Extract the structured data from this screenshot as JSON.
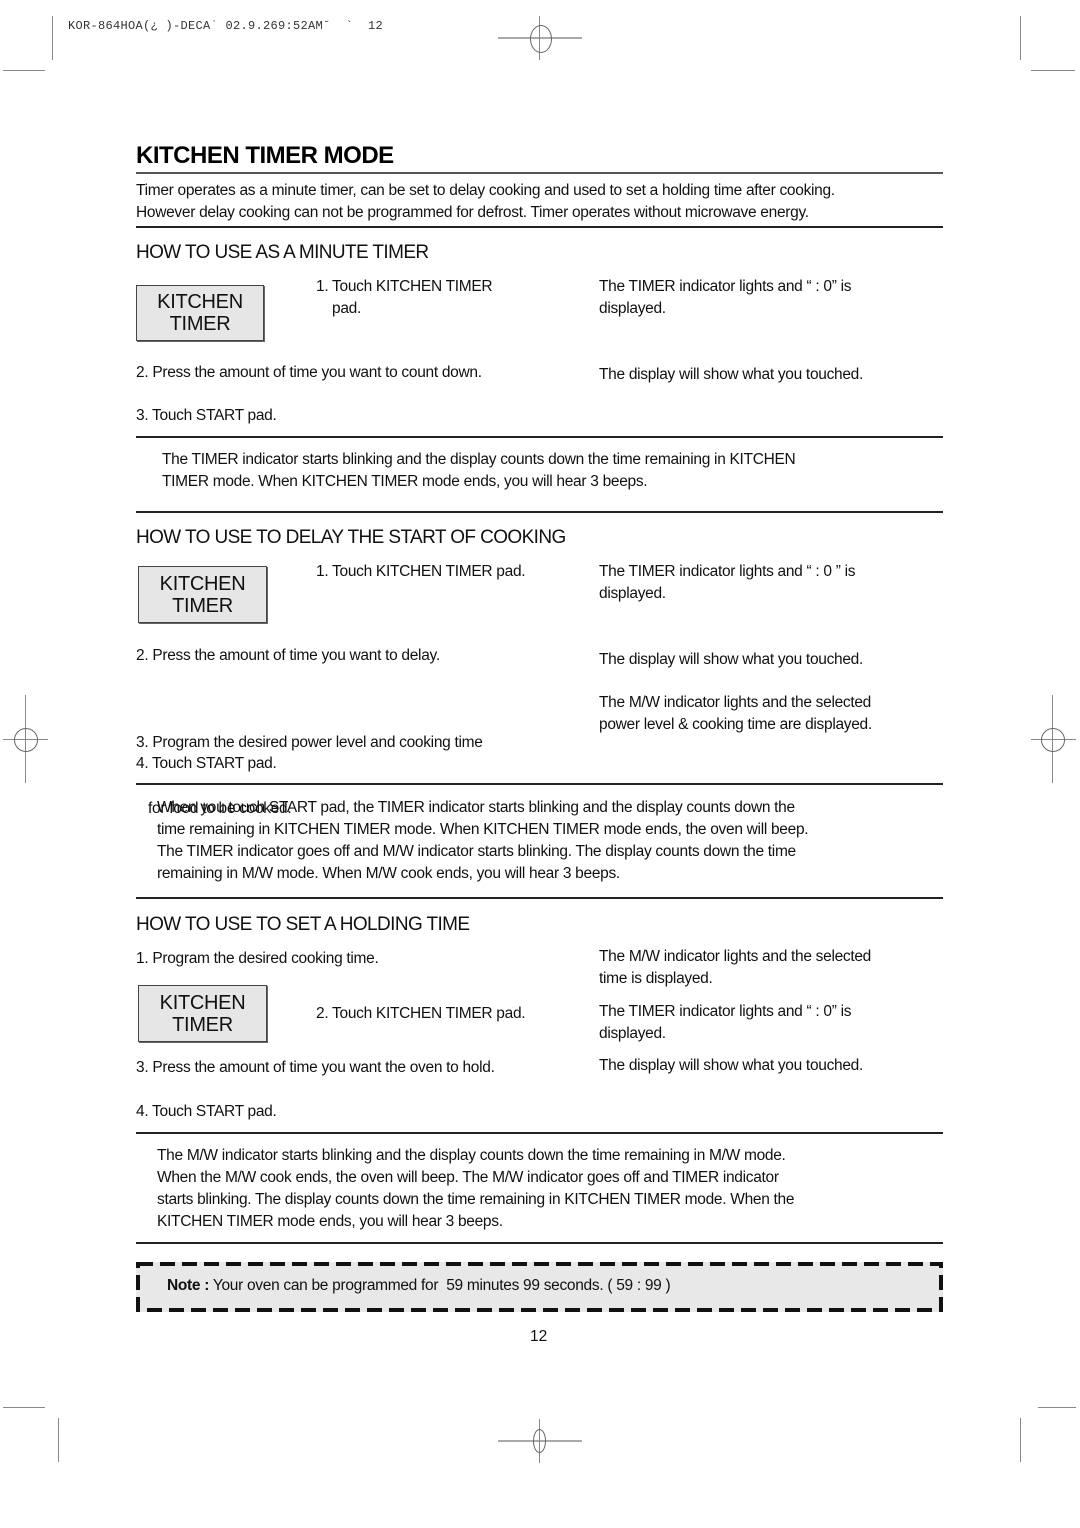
{
  "print_header": "KOR-864HOA(¿ )-DECA˙ 02.9.269:52AM˘  `  12",
  "title": "KITCHEN TIMER MODE",
  "intro": [
    "Timer operates as a minute timer, can be set to delay cooking and used to set a holding time after cooking.",
    "However delay cooking can not be programmed for defrost. Timer operates without microwave energy."
  ],
  "pad": {
    "line1": "KITCHEN",
    "line2": "TIMER"
  },
  "sections": [
    {
      "heading": "HOW TO USE AS A MINUTE TIMER",
      "steps": [
        {
          "instruction": [
            "1. Touch KITCHEN TIMER",
            "pad."
          ],
          "result": [
            "The TIMER indicator lights and   “ : 0” is",
            "displayed."
          ]
        },
        {
          "instruction": [
            "2. Press the amount of time you want to count down."
          ],
          "result": [
            "The display will show what you touched."
          ]
        },
        {
          "instruction": [
            "3. Touch START pad."
          ],
          "result": []
        }
      ],
      "summary": [
        "The TIMER indicator starts blinking and the display counts down the time remaining in KITCHEN",
        "TIMER mode. When KITCHEN TIMER mode ends, you will hear 3 beeps."
      ]
    },
    {
      "heading": "HOW TO USE TO DELAY THE START OF COOKING",
      "steps": [
        {
          "instruction": [
            "1. Touch KITCHEN TIMER pad."
          ],
          "result": [
            "The TIMER indicator lights and   “ : 0 ” is",
            "displayed."
          ]
        },
        {
          "instruction": [
            "2. Press the amount of time you want to delay."
          ],
          "result": [
            "The display will show what you touched."
          ]
        },
        {
          "instruction": [
            "3. Program the desired power level and cooking time",
            "   for food to be cooked."
          ],
          "result": [
            "The M/W indicator lights and the selected",
            "power level & cooking time are displayed."
          ]
        },
        {
          "instruction": [
            "4. Touch START pad."
          ],
          "result": []
        }
      ],
      "summary": [
        "When you touch START pad, the TIMER indicator starts blinking and the display counts down the",
        "time remaining in KITCHEN TIMER mode. When KITCHEN TIMER mode ends, the oven will beep.",
        "The TIMER indicator goes off and M/W indicator starts blinking. The display counts down the time",
        "remaining in M/W mode. When M/W cook ends, you will hear 3 beeps."
      ]
    },
    {
      "heading": "HOW TO USE TO SET A HOLDING TIME",
      "steps": [
        {
          "instruction": [
            "1. Program the desired cooking time."
          ],
          "result": [
            "The M/W indicator lights and the selected",
            "time is displayed."
          ]
        },
        {
          "instruction": [
            "2. Touch KITCHEN TIMER pad."
          ],
          "result": [
            "The TIMER indicator lights and   “ : 0” is",
            "displayed."
          ]
        },
        {
          "instruction": [
            "3. Press the amount of time you want the oven to hold."
          ],
          "result": [
            "The display will show what you touched."
          ]
        },
        {
          "instruction": [
            "4. Touch START pad."
          ],
          "result": []
        }
      ],
      "summary": [
        "The M/W indicator starts blinking and the display counts down the time remaining in M/W mode.",
        "When the M/W cook ends, the oven will beep. The M/W indicator goes off and TIMER indicator",
        "starts blinking. The display counts down the time remaining in KITCHEN TIMER mode. When the",
        "KITCHEN TIMER mode ends, you will hear 3 beeps."
      ]
    }
  ],
  "note": {
    "label": "Note :",
    "text": " Your oven can be programmed for  59 minutes 99 seconds. ( 59 : 99 )"
  },
  "page_number": "12"
}
